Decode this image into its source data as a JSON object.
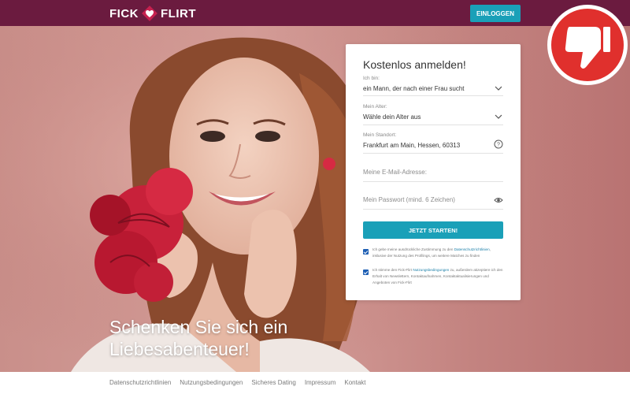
{
  "header": {
    "logo_left": "FICK",
    "logo_right": "FLIRT",
    "login_label": "EINLOGGEN",
    "background": "#6b1b3f",
    "accent": "#1aa0b8"
  },
  "hero": {
    "headline_line1": "Schenken Sie sich ein",
    "headline_line2": "Liebesabenteuer!"
  },
  "form": {
    "title": "Kostenlos anmelden!",
    "iam_label": "Ich bin:",
    "iam_value": "ein Mann, der nach einer Frau sucht",
    "age_label": "Mein Alter:",
    "age_value": "Wähle dein Alter aus",
    "location_label": "Mein Standort:",
    "location_value": "Frankfurt am Main, Hessen, 60313",
    "email_placeholder": "Meine E-Mail-Adresse:",
    "password_placeholder": "Mein Passwort (mind. 6 Zeichen)",
    "submit_label": "JETZT STARTEN!",
    "consent1_pre": "Ich gebe meine ausdrückliche Zustimmung zu den",
    "consent1_link": "Datenschutzrichtlinien",
    "consent1_post": ", inklusive der Nutzung des Profilings, um weitere Matches zu finden",
    "consent2_pre": "Ich stimme den Fick-Flirt",
    "consent2_link": "Nutzungsbedingungen",
    "consent2_post": "zu, außerdem akzeptiere ich den Erhalt von Newslettern, Kontaktaufnahmen, Kontaktaktualisierungen und Angeboten von Fick-Flirt"
  },
  "footer": {
    "links": [
      "Datenschutzrichtlinien",
      "Nutzungsbedingungen",
      "Sicheres Dating",
      "Impressum",
      "Kontakt"
    ]
  },
  "badge": {
    "icon": "thumbs-down-icon",
    "color": "#e0302d"
  }
}
